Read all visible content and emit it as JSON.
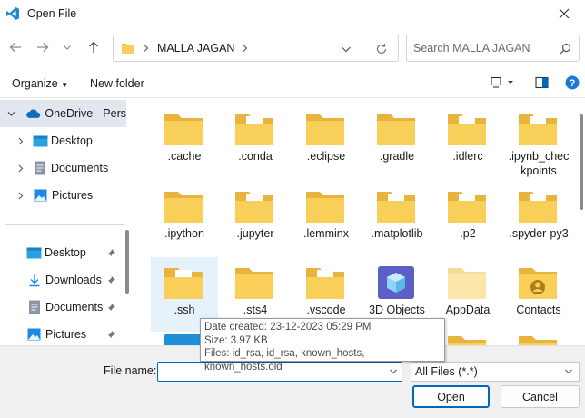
{
  "window": {
    "title": "Open File"
  },
  "address": {
    "folder": "MALLA JAGAN"
  },
  "search": {
    "placeholder": "Search MALLA JAGAN"
  },
  "toolbar": {
    "organize": "Organize",
    "new_folder": "New folder"
  },
  "sidebar": {
    "tree": [
      {
        "label": "OneDrive - Pers",
        "icon": "cloud-icon"
      },
      {
        "label": "Desktop",
        "icon": "desktop-icon"
      },
      {
        "label": "Documents",
        "icon": "documents-icon"
      },
      {
        "label": "Pictures",
        "icon": "pictures-icon"
      }
    ],
    "quick_access": [
      {
        "label": "Desktop",
        "icon": "desktop-icon"
      },
      {
        "label": "Downloads",
        "icon": "download-icon"
      },
      {
        "label": "Documents",
        "icon": "documents-icon"
      },
      {
        "label": "Pictures",
        "icon": "pictures-icon"
      }
    ]
  },
  "files": [
    ".cache",
    ".conda",
    ".eclipse",
    ".gradle",
    ".idlerc",
    ".ipynb_checkpoints",
    ".ipython",
    ".jupyter",
    ".lemminx",
    ".matplotlib",
    ".p2",
    ".spyder-py3",
    ".ssh",
    ".sts4",
    ".vscode",
    "3D Objects",
    "AppData",
    "Contacts"
  ],
  "tooltip": {
    "created": "Date created: 23-12-2023 05:29 PM",
    "size": "Size: 3.97 KB",
    "files": "Files: id_rsa, id_rsa, known_hosts, known_hosts.old"
  },
  "bottom": {
    "file_name_label": "File name:",
    "file_name_value": "",
    "file_type": "All Files (*.*)",
    "open_button": "Open",
    "cancel_button": "Cancel"
  },
  "colors": {
    "accent": "#0067c0",
    "folder": "#f8cf58",
    "folder_dark": "#e9b43d",
    "hover": "#e5f1fb",
    "selected": "#e1e6ef"
  }
}
